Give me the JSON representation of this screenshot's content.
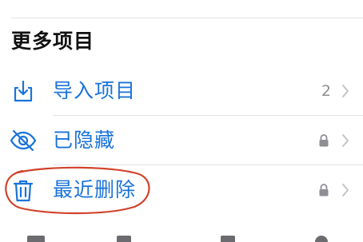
{
  "section": {
    "title": "更多项目"
  },
  "rows": [
    {
      "label": "导入项目",
      "icon": "import-icon",
      "count": "2",
      "locked": false
    },
    {
      "label": "已隐藏",
      "icon": "eye-hidden-icon",
      "count": "",
      "locked": true
    },
    {
      "label": "最近删除",
      "icon": "trash-icon",
      "count": "",
      "locked": true
    }
  ],
  "colors": {
    "accent": "#1a73d9",
    "secondary": "#8e8e93",
    "highlight": "#d0432c"
  }
}
